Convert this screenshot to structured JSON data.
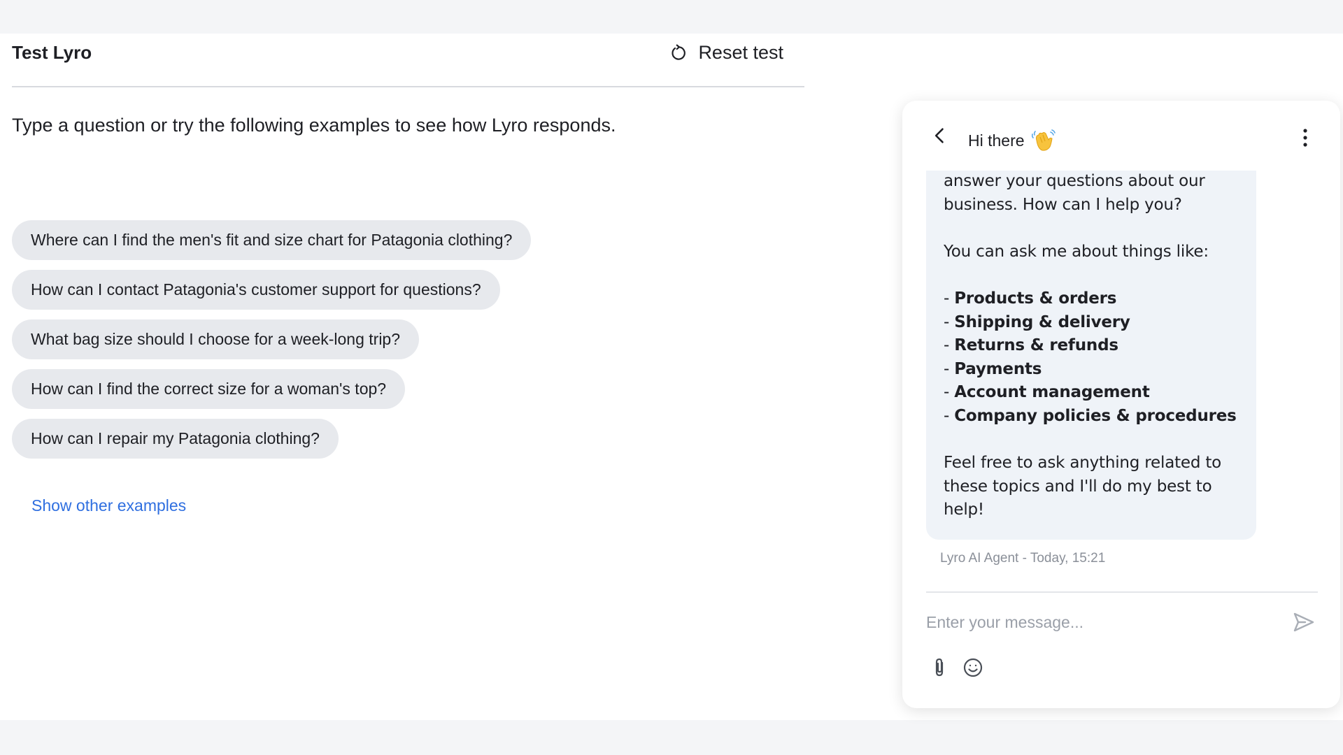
{
  "panel": {
    "title": "Test Lyro",
    "reset_label": "Reset test",
    "intro": "Type a question or try the following examples to see how Lyro responds.",
    "examples": [
      "Where can I find the men's fit and size chart for Patagonia clothing?",
      "How can I contact Patagonia's customer support for questions?",
      "What bag size should I choose for a week-long trip?",
      "How can I find the correct size for a woman's top?",
      "How can I repair my Patagonia clothing?"
    ],
    "show_more": "Show other examples"
  },
  "chat": {
    "title": "Hi there",
    "message": {
      "intro_line1": "answer your questions about our",
      "intro_line2": "business. How can I help you?",
      "ask_line": "You can ask me about things like:",
      "bullet_prefix": "- ",
      "topics": [
        "Products & orders",
        "Shipping & delivery",
        "Returns & refunds",
        "Payments",
        "Account management",
        "Company policies & procedures"
      ],
      "outro_line1": "Feel free to ask anything related to",
      "outro_line2": "these topics and I'll do my best to",
      "outro_line3": "help!"
    },
    "meta": "Lyro AI Agent - Today, 15:21",
    "input_placeholder": "Enter your message..."
  },
  "colors": {
    "accent_link": "#2f6fe0",
    "pill_bg": "#e7e9ed",
    "bubble_bg": "#eff3f8",
    "page_strip": "#f4f5f7"
  },
  "icons": {
    "reset": "refresh-icon",
    "back": "chevron-left-icon",
    "wave": "waving-hand-icon",
    "menu": "kebab-menu-icon",
    "send": "send-icon",
    "attach": "paperclip-icon",
    "emoji": "smiley-icon"
  }
}
